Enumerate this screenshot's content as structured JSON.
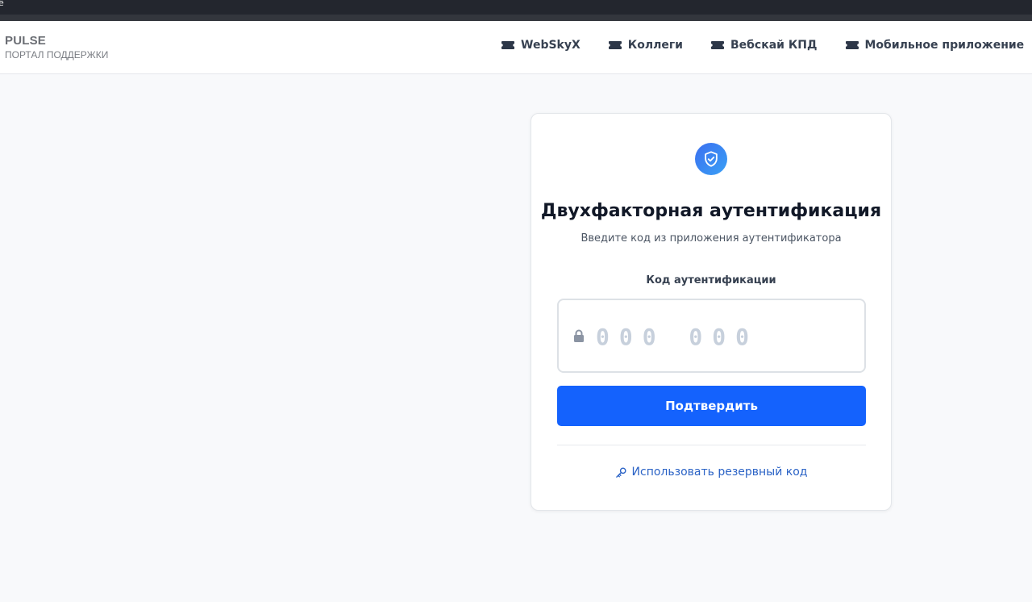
{
  "browser": {
    "corner_glyph": "ë"
  },
  "header": {
    "brand_title": "PULSE",
    "brand_subtitle": "ПОРТАЛ ПОДДЕРЖКИ",
    "nav": [
      {
        "label": "WebSkyX",
        "icon": "ticket-icon"
      },
      {
        "label": "Коллеги",
        "icon": "ticket-icon"
      },
      {
        "label": "Вебскай КПД",
        "icon": "ticket-icon"
      },
      {
        "label": "Мобильное приложение",
        "icon": "ticket-icon"
      }
    ]
  },
  "auth": {
    "icon": "shield-check-icon",
    "title": "Двухфакторная аутентификация",
    "subtitle": "Введите код из приложения аутентификатора",
    "field_label": "Код аутентификации",
    "code_placeholder": "000 000",
    "code_value": "",
    "submit_label": "Подтвердить",
    "backup_link_label": "Использовать резервный код"
  },
  "colors": {
    "primary": "#1462fd",
    "link": "#2b63c6",
    "page_bg": "#f8f9fb"
  }
}
